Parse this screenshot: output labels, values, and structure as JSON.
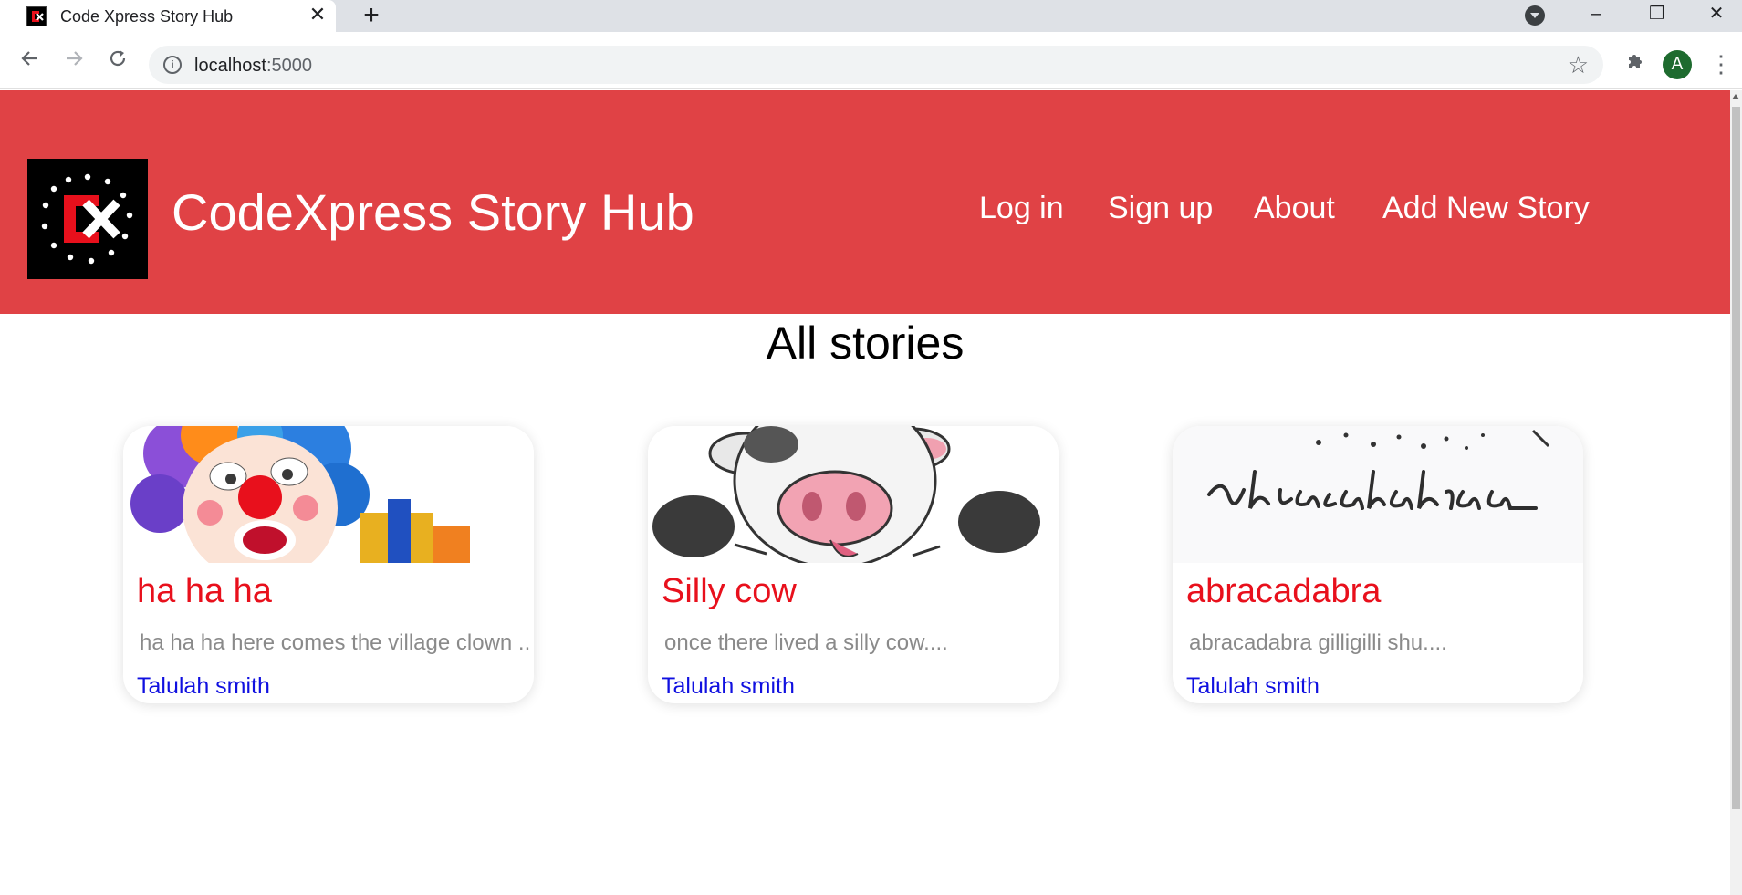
{
  "browser": {
    "tab_title": "Code Xpress Story Hub",
    "tab_close": "✕",
    "new_tab": "+",
    "url_host": "localhost",
    "url_port": ":5000",
    "profile_initial": "A",
    "window_controls": {
      "minimize": "–",
      "restore": "❐",
      "close": "✕"
    },
    "icons": [
      "back-arrow-icon",
      "forward-arrow-icon",
      "reload-icon",
      "info-icon",
      "star-icon",
      "extensions-icon",
      "menu-icon"
    ]
  },
  "header": {
    "title": "CodeXpress Story Hub",
    "nav": [
      {
        "label": "Log in"
      },
      {
        "label": "Sign up"
      },
      {
        "label": "About"
      },
      {
        "label": "Add New Story"
      }
    ],
    "color": "#e04245"
  },
  "main": {
    "heading": "All stories",
    "stories": [
      {
        "title": "ha ha ha",
        "excerpt": "ha ha ha here comes the village clown ..",
        "author": "Talulah smith",
        "image": "clown-image"
      },
      {
        "title": "Silly cow",
        "excerpt": "once there lived a silly cow....",
        "author": "Talulah smith",
        "image": "cow-image"
      },
      {
        "title": "abracadabra",
        "excerpt": "abracadabra gilligilli shu....",
        "author": "Talulah smith",
        "image": "abracadabra-image"
      }
    ]
  },
  "colors": {
    "card_title": "#e8101c",
    "card_author": "#1010e0",
    "card_text": "#8a8a8a"
  }
}
